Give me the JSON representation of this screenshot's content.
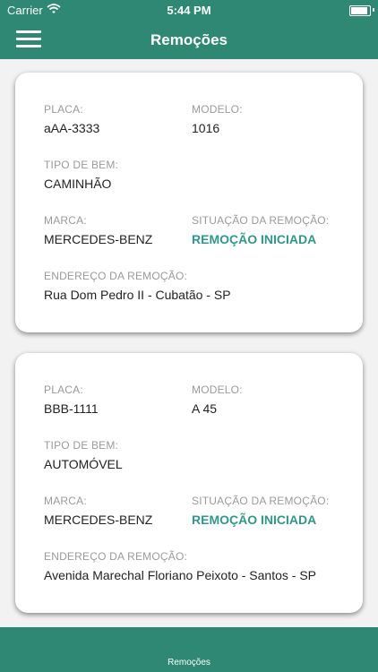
{
  "status_bar": {
    "carrier": "Carrier",
    "time": "5:44 PM"
  },
  "header": {
    "title": "Remoções",
    "menu_icon": "hamburger-menu-icon"
  },
  "cards": [
    {
      "placa_label": "PLACA:",
      "placa": "aAA-3333",
      "modelo_label": "MODELO:",
      "modelo": "1016",
      "tipo_label": "TIPO DE BEM:",
      "tipo": "CAMINHÃO",
      "marca_label": "MARCA:",
      "marca": "MERCEDES-BENZ",
      "situacao_label": "SITUAÇÃO DA REMOÇÃO:",
      "situacao": "REMOÇÃO INICIADA",
      "endereco_label": "ENDEREÇO DA REMOÇÃO:",
      "endereco": "Rua Dom Pedro II - Cubatão - SP"
    },
    {
      "placa_label": "PLACA:",
      "placa": "BBB-1111",
      "modelo_label": "MODELO:",
      "modelo": "A 45",
      "tipo_label": "TIPO DE BEM:",
      "tipo": "AUTOMÓVEL",
      "marca_label": "MARCA:",
      "marca": "MERCEDES-BENZ",
      "situacao_label": "SITUAÇÃO DA REMOÇÃO:",
      "situacao": "REMOÇÃO INICIADA",
      "endereco_label": "ENDEREÇO DA REMOÇÃO:",
      "endereco": "Avenida Marechal Floriano Peixoto - Santos - SP"
    }
  ],
  "tab_bar": {
    "label": "Remoções"
  },
  "colors": {
    "primary": "#2e8873",
    "status": "#2b9a8b",
    "background": "#f2f2f2"
  }
}
